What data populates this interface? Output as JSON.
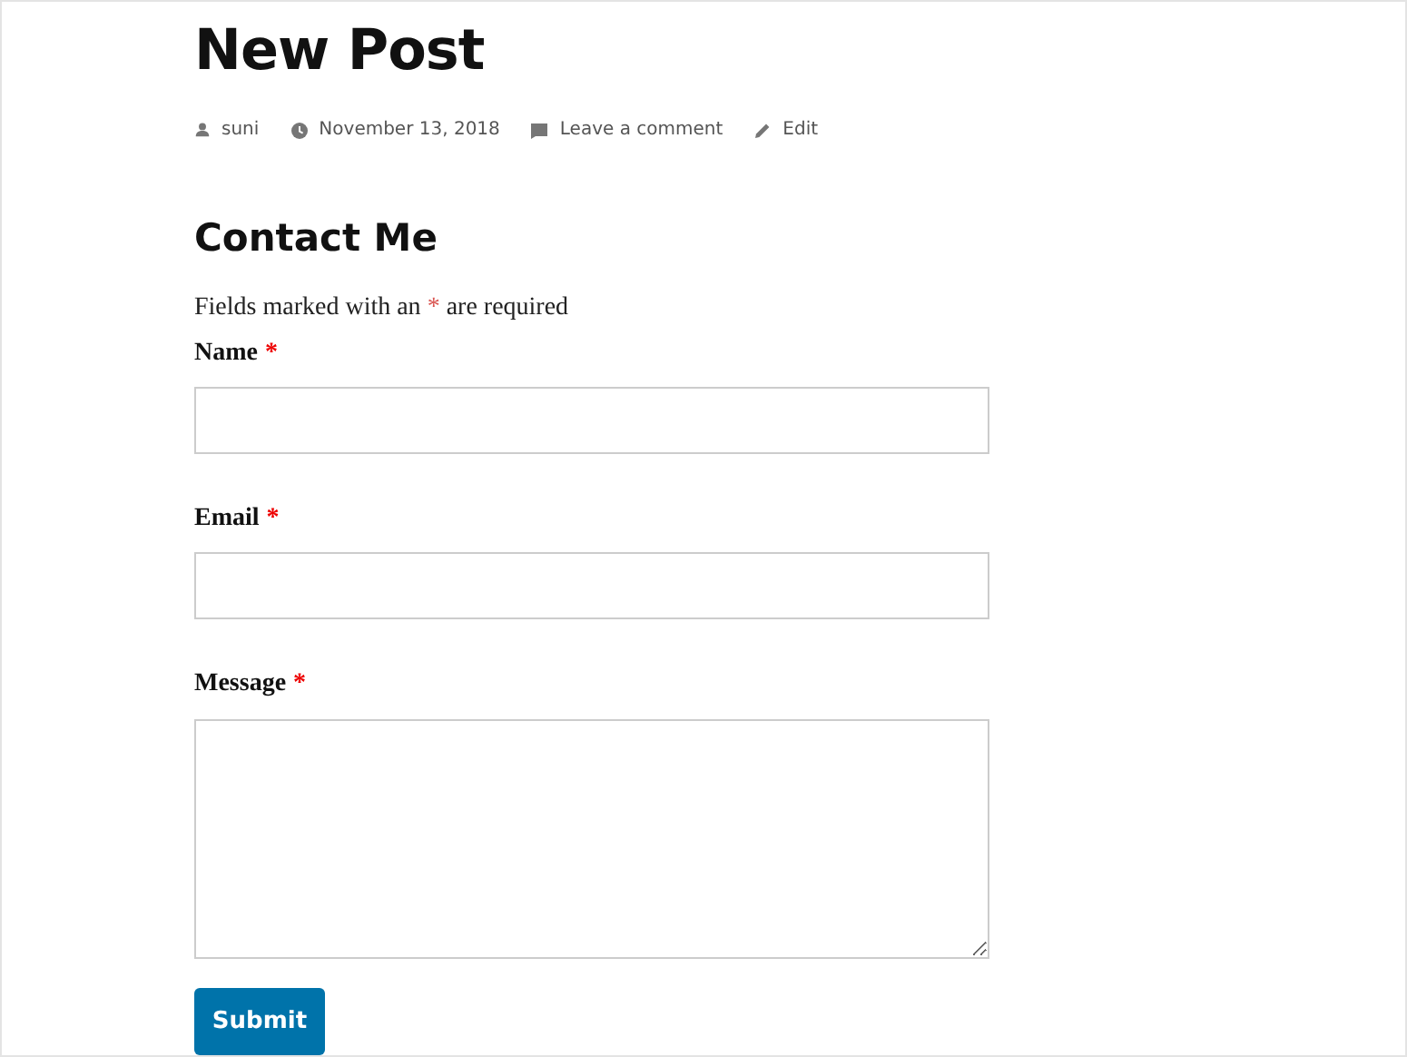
{
  "post": {
    "title": "New Post",
    "meta": [
      {
        "kind": "author",
        "text": "suni"
      },
      {
        "kind": "date",
        "text": "November 13, 2018"
      },
      {
        "kind": "comment",
        "text": "Leave a comment"
      },
      {
        "kind": "edit",
        "text": "Edit"
      }
    ]
  },
  "form": {
    "title": "Contact Me",
    "intro": {
      "before": "Fields marked with an",
      "mark": "*",
      "after": "are required"
    },
    "fields": [
      {
        "label": "Name",
        "required_mark": "*",
        "kind": "input"
      },
      {
        "label": "Email",
        "required_mark": "*",
        "kind": "input"
      },
      {
        "label": "Message",
        "required_mark": "*",
        "kind": "textarea"
      }
    ],
    "submit": "Submit"
  }
}
